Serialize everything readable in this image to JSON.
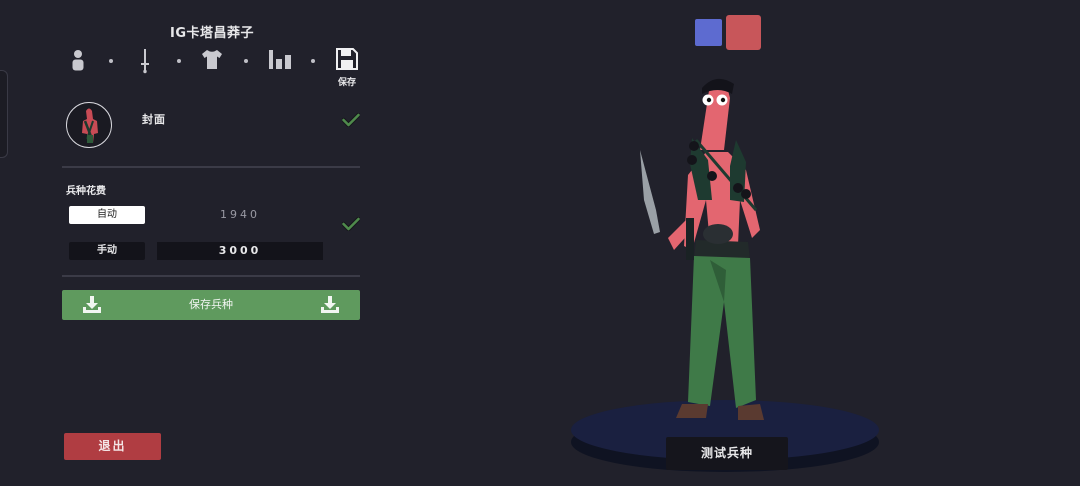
{
  "unit_name": "IG卡塔昌莽子",
  "step_icons": [
    "person-icon",
    "sword-icon",
    "shirt-icon",
    "stats-icon",
    "floppy-disk-icon"
  ],
  "save_step_label": "保存",
  "cover": {
    "label": "封面"
  },
  "cost_section": {
    "title": "兵种花费",
    "auto_label": "自动",
    "auto_value": "1940",
    "manual_label": "手动",
    "manual_value": "3000"
  },
  "save_unit_label": "保存兵种",
  "exit_label": "退出",
  "test_unit_label": "测试兵种",
  "colors": {
    "background": "#21212b",
    "team_blue": "#5d6bd0",
    "team_red": "#c8565a",
    "save_green": "#5f9a5e",
    "exit_red": "#b03d42",
    "check_green": "#4f8a4c"
  }
}
